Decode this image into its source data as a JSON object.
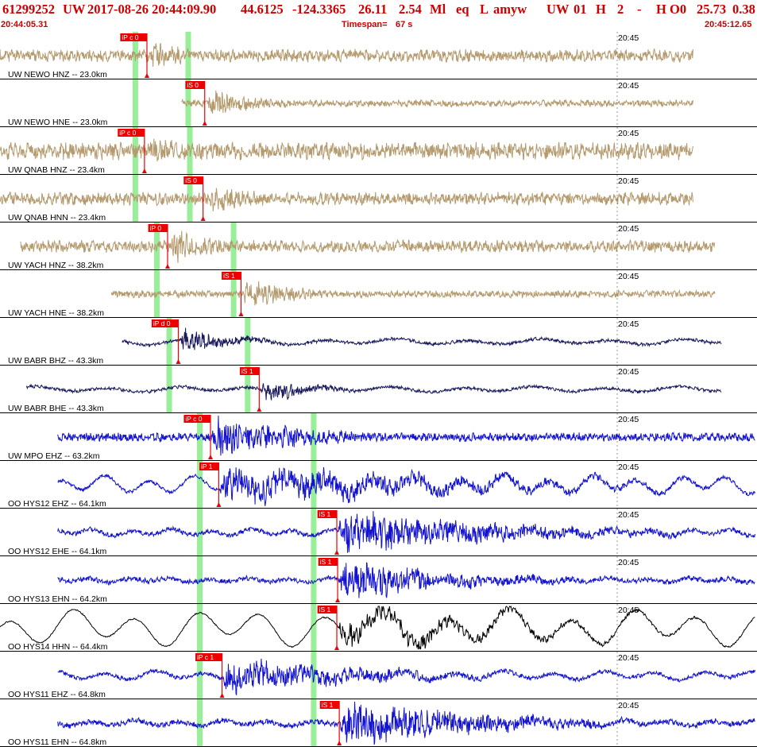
{
  "header": {
    "event_id": "61299252",
    "network": "UW",
    "origin_datetime": "2017-08-26 20:44:09.90",
    "latitude": "44.6125",
    "longitude": "-124.3365",
    "depth": "26.11",
    "magnitude": "2.54",
    "mag_type": "Ml",
    "event_type": "eq",
    "location_flag": "L",
    "author": "amyw",
    "source_net": "UW",
    "version": "01",
    "review_flag": "H",
    "count": "2",
    "dash": "-",
    "solution_flag": "H",
    "subsource": "O0",
    "distance": "25.73",
    "rms": "0.38",
    "start_time": "20:44:05.31",
    "timespan_label": "Timespan=",
    "timespan_value": "67 s",
    "end_time": "20:45:12.65"
  },
  "colors": {
    "header_red": "#cc0000",
    "pick_red": "#ee0000",
    "pick_flag": "#ee0000",
    "green_bar": "#99ee99",
    "trace_tan": "#b59a6e",
    "trace_navy": "#1a1a5e",
    "trace_blue": "#1414d0",
    "trace_black": "#000000",
    "divider": "#000000"
  },
  "time_tick_label": "20:45",
  "channels": [
    {
      "label": "UW NEWO HNZ -- 23.0km",
      "pick": "iP c 0",
      "color": "tan",
      "pick_time": 17.8,
      "green": [
        16.4,
        22.8
      ],
      "start": 0,
      "end": 84,
      "amp": 14,
      "noise": 0.45,
      "coda": 8,
      "lp": 0,
      "lp_amp": 0
    },
    {
      "label": "UW NEWO HNE -- 23.0km",
      "pick": "iS 0",
      "color": "tan",
      "pick_time": 24.8,
      "green": [
        16.4,
        22.8
      ],
      "start": 22,
      "end": 84,
      "amp": 16,
      "noise": 0.22,
      "coda": 7,
      "lp": 0,
      "lp_amp": 0
    },
    {
      "label": "UW QNAB HNZ -- 23.4km",
      "pick": "iP c 0",
      "color": "tan",
      "pick_time": 17.5,
      "green": [
        16.4,
        23.0
      ],
      "start": 0,
      "end": 84,
      "amp": 16,
      "noise": 0.55,
      "coda": 8,
      "lp": 0,
      "lp_amp": 0
    },
    {
      "label": "UW QNAB HNN -- 23.4km",
      "pick": "iS 0",
      "color": "tan",
      "pick_time": 24.6,
      "green": [
        16.4,
        23.0
      ],
      "start": 0,
      "end": 84,
      "amp": 16,
      "noise": 0.4,
      "coda": 8,
      "lp": 0,
      "lp_amp": 0
    },
    {
      "label": "UW YACH HNZ -- 38.2km",
      "pick": "iP 0",
      "color": "tan",
      "pick_time": 20.3,
      "green": [
        19.0,
        28.3
      ],
      "start": 2.5,
      "end": 86.6,
      "amp": 20,
      "noise": 0.3,
      "coda": 7,
      "lp": 0,
      "lp_amp": 0
    },
    {
      "label": "UW YACH HNE -- 38.2km",
      "pick": "iS 1",
      "color": "tan",
      "pick_time": 29.2,
      "green": [
        19.0,
        28.3
      ],
      "start": 13.5,
      "end": 86.6,
      "amp": 18,
      "noise": 0.2,
      "coda": 7,
      "lp": 0,
      "lp_amp": 0
    },
    {
      "label": "UW BABR BHZ -- 43.3km",
      "pick": "iP d 0",
      "color": "navy",
      "pick_time": 21.6,
      "green": [
        20.5,
        30.0
      ],
      "start": 14.8,
      "end": 87.4,
      "amp": 14,
      "noise": 0.12,
      "coda": 6,
      "lp": 0.28,
      "lp_amp": 2.5
    },
    {
      "label": "UW BABR BHE -- 43.3km",
      "pick": "iS 1",
      "color": "navy",
      "pick_time": 31.4,
      "green": [
        20.5,
        30.0
      ],
      "start": 3.2,
      "end": 87.4,
      "amp": 14,
      "noise": 0.12,
      "coda": 6,
      "lp": 0.28,
      "lp_amp": 2.5
    },
    {
      "label": "UW MPO EHZ -- 63.2km",
      "pick": "iP c 0",
      "color": "blue",
      "pick_time": 25.5,
      "green": [
        24.2,
        38.0
      ],
      "start": 7,
      "end": 91.5,
      "amp": 24,
      "noise": 0.18,
      "coda": 12,
      "lp": 0,
      "lp_amp": 0
    },
    {
      "label": "OO HYS12 EHZ -- 64.1km",
      "pick": "iP 1",
      "color": "blue",
      "pick_time": 26.5,
      "green": [
        24.2,
        38.0
      ],
      "start": 7,
      "end": 91.5,
      "amp": 18,
      "noise": 0.1,
      "coda": 28,
      "lp": 0.45,
      "lp_amp": 8
    },
    {
      "label": "OO HYS12 EHE -- 64.1km",
      "pick": "iS 1",
      "color": "blue",
      "pick_time": 40.8,
      "green": [
        24.2,
        38.0
      ],
      "start": 7,
      "end": 91.5,
      "amp": 24,
      "noise": 0.1,
      "coda": 20,
      "lp": 0.5,
      "lp_amp": 3
    },
    {
      "label": "OO HYS13 EHN -- 64.2km",
      "pick": "iS 1",
      "color": "blue",
      "pick_time": 40.9,
      "green": [
        24.2,
        38.0
      ],
      "start": 7,
      "end": 91.5,
      "amp": 22,
      "noise": 0.12,
      "coda": 14,
      "lp": 0.5,
      "lp_amp": 2
    },
    {
      "label": "OO HYS14 HHN -- 64.4km",
      "pick": "iS 1",
      "color": "black",
      "pick_time": 40.8,
      "green": [
        24.2,
        38.0
      ],
      "start": 0,
      "end": 91.5,
      "amp": 14,
      "noise": 0.05,
      "coda": 18,
      "lp": 0.32,
      "lp_amp": 16
    },
    {
      "label": "OO HYS11 EHZ -- 64.8km",
      "pick": "iP c 1",
      "color": "blue",
      "pick_time": 26.9,
      "green": [
        24.2,
        38.0
      ],
      "start": 7,
      "end": 91.5,
      "amp": 18,
      "noise": 0.12,
      "coda": 18,
      "lp": 0.4,
      "lp_amp": 4
    },
    {
      "label": "OO HYS11 EHN -- 64.8km",
      "pick": "iS 1",
      "color": "blue",
      "pick_time": 41.1,
      "green": [
        24.2,
        38.0
      ],
      "start": 7,
      "end": 91.5,
      "amp": 24,
      "noise": 0.12,
      "coda": 18,
      "lp": 0.45,
      "lp_amp": 2.5
    }
  ]
}
